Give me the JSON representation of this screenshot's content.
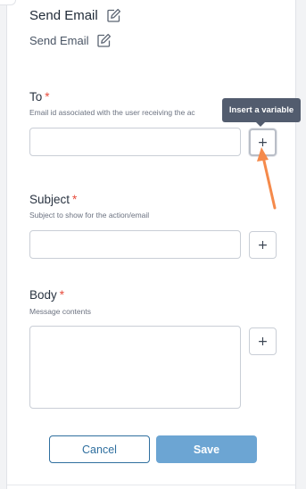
{
  "header": {
    "title": "Send Email",
    "subtitle": "Send Email",
    "edit_icon": "edit-pencil-icon"
  },
  "fields": {
    "to": {
      "label": "To",
      "required_mark": "*",
      "hint": "Email id associated with the user receiving the ac",
      "value": ""
    },
    "subject": {
      "label": "Subject",
      "required_mark": "*",
      "hint": "Subject to show for the action/email",
      "value": ""
    },
    "body": {
      "label": "Body",
      "required_mark": "*",
      "hint": "Message contents",
      "value": ""
    }
  },
  "insert_variable": {
    "button_label": "+",
    "tooltip": "Insert a variable"
  },
  "actions": {
    "cancel_label": "Cancel",
    "save_label": "Save"
  },
  "colors": {
    "accent": "#2f6f9f",
    "save_bg": "#6ca5d3",
    "required": "#e74c3c",
    "tooltip_bg": "#525c6e",
    "annotation_arrow": "#f58a4b"
  }
}
